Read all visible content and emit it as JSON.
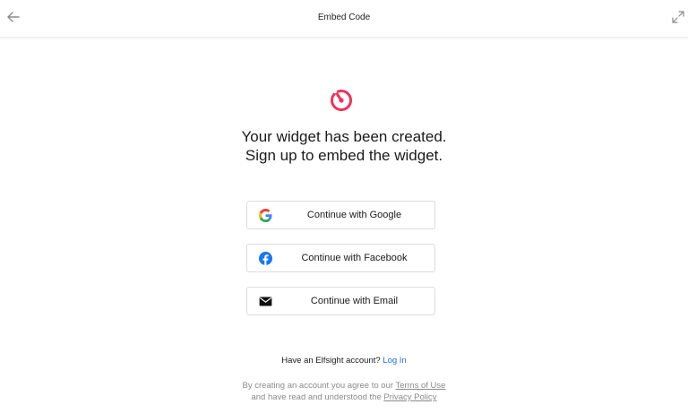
{
  "header": {
    "title": "Embed Code",
    "back_icon": "arrow-left-icon",
    "expand_icon": "expand-icon"
  },
  "brand": {
    "logo_icon": "elfsight-logo-icon",
    "accent_color": "#f0325b"
  },
  "main": {
    "headline_line1": "Your widget has been created.",
    "headline_line2": "Sign up to embed the widget."
  },
  "auth": {
    "google_label": "Continue with Google",
    "facebook_label": "Continue with Facebook",
    "email_label": "Continue with Email"
  },
  "footer": {
    "have_account_text": "Have an Elfsight account?",
    "login_link": "Log In",
    "terms_prefix": "By creating an account you agree to our",
    "terms_link": "Terms of Use",
    "privacy_prefix": "and have read and understood the",
    "privacy_link": "Privacy Policy"
  }
}
